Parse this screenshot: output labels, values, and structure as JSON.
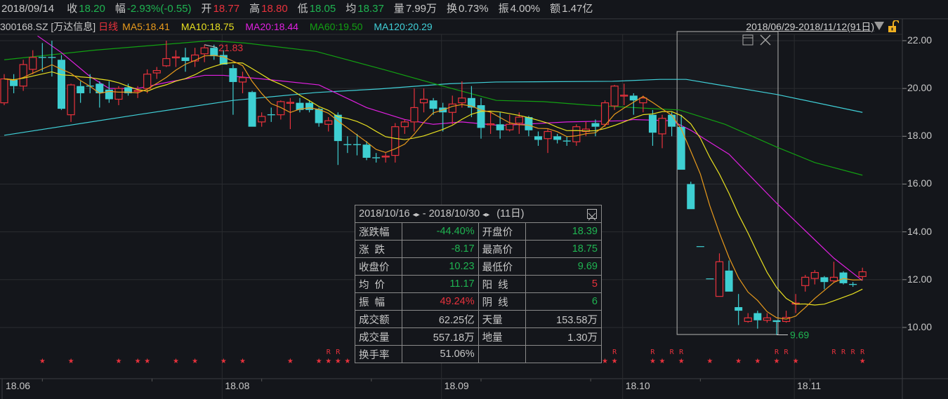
{
  "header": {
    "date": "2018/09/14",
    "items": [
      {
        "label": "收",
        "value": "18.20",
        "color": "g"
      },
      {
        "label": "幅",
        "value": "-2.93%(-0.55)",
        "color": "g"
      },
      {
        "label": "开",
        "value": "18.77",
        "color": "r"
      },
      {
        "label": "高",
        "value": "18.80",
        "color": "r"
      },
      {
        "label": "低",
        "value": "18.05",
        "color": "g"
      },
      {
        "label": "均",
        "value": "18.37",
        "color": "g"
      },
      {
        "label": "量",
        "value": "7.99万",
        "color": "w"
      },
      {
        "label": "换",
        "value": "0.73%",
        "color": "w"
      },
      {
        "label": "振",
        "value": "4.00%",
        "color": "w"
      },
      {
        "label": "额",
        "value": "1.47亿",
        "color": "w"
      }
    ]
  },
  "symbol": "300168.SZ [万达信息]",
  "period": "日线",
  "ma_legend": [
    {
      "label": "MA5:18.41",
      "color": "#e89a1c"
    },
    {
      "label": "MA10:18.75",
      "color": "#e8e020"
    },
    {
      "label": "MA20:18.44",
      "color": "#e020e0"
    },
    {
      "label": "MA60:19.50",
      "color": "#12a012"
    },
    {
      "label": "MA120:20.29",
      "color": "#40d0d8"
    }
  ],
  "range_label": "2018/06/29-2018/11/12(91日)",
  "stats": {
    "title_start": "2018/10/16",
    "title_end": "2018/10/30",
    "days": "(11日)",
    "rows": [
      {
        "l1": "涨跌幅",
        "v1": "-44.40%",
        "c1": "g",
        "l2": "开盘价",
        "v2": "18.39",
        "c2": "g"
      },
      {
        "l1": "涨  跌",
        "v1": "-8.17",
        "c1": "g",
        "l2": "最高价",
        "v2": "18.75",
        "c2": "g"
      },
      {
        "l1": "收盘价",
        "v1": "10.23",
        "c1": "g",
        "l2": "最低价",
        "v2": "9.69",
        "c2": "g"
      },
      {
        "l1": "均  价",
        "v1": "11.17",
        "c1": "g",
        "l2": "阳  线",
        "v2": "5",
        "c2": "r"
      },
      {
        "l1": "振  幅",
        "v1": "49.24%",
        "c1": "r",
        "l2": "阴  线",
        "v2": "6",
        "c2": "g"
      },
      {
        "l1": "成交额",
        "v1": "62.25亿",
        "c1": "w",
        "l2": "天量",
        "v2": "153.58万",
        "c2": "w"
      },
      {
        "l1": "成交量",
        "v1": "557.18万",
        "c1": "w",
        "l2": "地量",
        "v2": "1.30万",
        "c2": "w"
      },
      {
        "l1": "换手率",
        "v1": "51.06%",
        "c1": "w",
        "l2": "",
        "v2": "",
        "c2": "w"
      }
    ]
  },
  "chart_data": {
    "type": "candlestick",
    "ylim": [
      9.0,
      22.6
    ],
    "y_ticks": [
      "22.00",
      "20.00",
      "18.00",
      "16.00",
      "14.00",
      "12.00",
      "10.00"
    ],
    "x_ticks": [
      {
        "label": "18.06",
        "index": 0
      },
      {
        "label": "18.08",
        "index": 23
      },
      {
        "label": "18.09",
        "index": 46
      },
      {
        "label": "18.10",
        "index": 65
      },
      {
        "label": "18.11",
        "index": 83
      }
    ],
    "colors": {
      "up": "#e8323c",
      "down": "#3ecfd2"
    },
    "ohlc": [
      [
        19.4,
        20.6,
        19.3,
        20.4
      ],
      [
        20.36,
        20.6,
        19.8,
        20.1
      ],
      [
        20.1,
        21.2,
        19.9,
        21.0
      ],
      [
        20.8,
        21.6,
        20.6,
        21.3
      ],
      [
        21.32,
        21.9,
        20.7,
        21.28
      ],
      [
        21.32,
        22.0,
        20.5,
        21.28
      ],
      [
        21.2,
        21.4,
        19.1,
        19.15
      ],
      [
        18.9,
        20.2,
        18.6,
        20.15
      ],
      [
        20.1,
        20.3,
        19.4,
        19.8
      ],
      [
        20.12,
        20.6,
        19.8,
        20.08
      ],
      [
        20.2,
        20.3,
        19.2,
        19.8
      ],
      [
        19.95,
        20.3,
        19.4,
        19.55
      ],
      [
        19.55,
        20.1,
        19.3,
        20.0
      ],
      [
        20.05,
        20.2,
        19.7,
        19.8
      ],
      [
        19.88,
        20.1,
        19.6,
        19.92
      ],
      [
        20.0,
        20.8,
        19.8,
        20.6
      ],
      [
        20.65,
        20.9,
        20.4,
        20.75
      ],
      [
        20.95,
        22.0,
        20.9,
        21.25
      ],
      [
        21.28,
        21.6,
        20.9,
        21.32
      ],
      [
        21.3,
        21.7,
        20.7,
        21.15
      ],
      [
        21.15,
        21.7,
        20.9,
        21.4
      ],
      [
        21.45,
        21.83,
        21.1,
        21.7
      ],
      [
        21.7,
        21.83,
        21.2,
        21.35
      ],
      [
        21.4,
        21.6,
        21.0,
        21.0
      ],
      [
        20.85,
        21.0,
        18.9,
        20.27
      ],
      [
        20.27,
        20.7,
        19.8,
        20.45
      ],
      [
        19.85,
        19.9,
        18.4,
        18.4
      ],
      [
        18.6,
        19.0,
        18.4,
        18.83
      ],
      [
        18.92,
        19.2,
        18.6,
        18.88
      ],
      [
        18.9,
        19.5,
        18.7,
        19.45
      ],
      [
        19.38,
        19.6,
        18.3,
        19.42
      ],
      [
        19.4,
        19.6,
        19.0,
        19.1
      ],
      [
        19.4,
        19.5,
        19.0,
        19.1
      ],
      [
        19.15,
        19.2,
        18.4,
        18.55
      ],
      [
        18.5,
        18.8,
        18.2,
        18.65
      ],
      [
        18.9,
        19.0,
        16.8,
        17.8
      ],
      [
        17.67,
        18.0,
        17.3,
        17.63
      ],
      [
        17.67,
        18.1,
        17.2,
        17.63
      ],
      [
        17.65,
        17.8,
        17.0,
        17.1
      ],
      [
        17.12,
        17.3,
        16.9,
        17.08
      ],
      [
        17.13,
        17.3,
        16.9,
        17.17
      ],
      [
        17.2,
        18.55,
        16.9,
        18.4
      ],
      [
        18.4,
        18.7,
        18.1,
        18.6
      ],
      [
        18.6,
        20.0,
        18.2,
        19.2
      ],
      [
        19.4,
        20.0,
        19.0,
        19.55
      ],
      [
        19.5,
        19.6,
        18.9,
        19.15
      ],
      [
        19.2,
        19.4,
        18.2,
        19.0
      ],
      [
        19.0,
        19.7,
        18.5,
        19.35
      ],
      [
        19.4,
        20.3,
        19.2,
        19.6
      ],
      [
        19.6,
        20.1,
        18.8,
        19.2
      ],
      [
        19.3,
        19.6,
        17.9,
        18.35
      ],
      [
        18.48,
        19.0,
        18.1,
        18.52
      ],
      [
        18.5,
        19.0,
        17.9,
        18.25
      ],
      [
        18.27,
        18.9,
        18.2,
        18.5
      ],
      [
        18.55,
        19.0,
        18.1,
        18.8
      ],
      [
        18.8,
        18.85,
        18.0,
        18.25
      ],
      [
        18.0,
        18.2,
        17.6,
        17.85
      ],
      [
        17.9,
        18.3,
        17.3,
        18.2
      ],
      [
        18.0,
        18.1,
        17.7,
        17.85
      ],
      [
        17.82,
        18.0,
        17.6,
        17.78
      ],
      [
        17.77,
        18.5,
        17.6,
        18.4
      ],
      [
        18.2,
        18.6,
        18.0,
        18.3
      ],
      [
        18.55,
        18.7,
        18.0,
        18.4
      ],
      [
        18.5,
        19.5,
        18.4,
        19.4
      ],
      [
        19.27,
        20.15,
        19.1,
        20.1
      ],
      [
        19.68,
        20.2,
        19.3,
        19.72
      ],
      [
        19.7,
        19.8,
        18.9,
        19.5
      ],
      [
        19.4,
        19.7,
        19.0,
        19.6
      ],
      [
        18.9,
        19.1,
        17.6,
        18.15
      ],
      [
        18.1,
        18.9,
        17.5,
        18.75
      ],
      [
        18.9,
        19.0,
        18.0,
        18.4
      ],
      [
        18.39,
        18.9,
        16.6,
        16.6
      ],
      [
        16.0,
        16.1,
        14.95,
        14.95
      ],
      [
        13.4,
        13.4,
        13.4,
        13.4
      ],
      [
        12.05,
        12.05,
        12.05,
        12.05
      ],
      [
        11.3,
        13.1,
        11.3,
        12.75
      ],
      [
        12.38,
        12.8,
        11.5,
        11.5
      ],
      [
        10.85,
        11.4,
        10.1,
        10.7
      ],
      [
        10.25,
        10.6,
        10.2,
        10.4
      ],
      [
        10.6,
        10.7,
        9.95,
        10.3
      ],
      [
        10.3,
        10.6,
        10.2,
        10.4
      ],
      [
        10.3,
        10.3,
        9.69,
        10.23
      ],
      [
        10.25,
        10.7,
        10.2,
        10.42
      ],
      [
        10.98,
        11.4,
        10.6,
        11.02
      ],
      [
        11.75,
        12.2,
        11.5,
        12.1
      ],
      [
        12.05,
        12.4,
        11.8,
        12.3
      ],
      [
        12.1,
        12.15,
        11.6,
        11.9
      ],
      [
        11.95,
        12.75,
        11.9,
        12.1
      ],
      [
        12.3,
        12.35,
        11.8,
        11.85
      ],
      [
        11.82,
        11.9,
        11.7,
        11.78
      ],
      [
        12.13,
        12.5,
        12.0,
        12.33
      ]
    ],
    "ma20_points": [
      [
        3.5,
        22.2
      ],
      [
        6,
        21.5
      ],
      [
        9,
        20.5
      ],
      [
        11,
        20.0
      ],
      [
        14,
        20.0
      ],
      [
        17,
        20.25
      ],
      [
        21,
        20.55
      ],
      [
        23,
        20.55
      ],
      [
        27,
        20.4
      ],
      [
        33,
        20.15
      ],
      [
        38,
        19.2
      ],
      [
        42,
        18.7
      ],
      [
        45,
        18.5
      ],
      [
        48,
        18.6
      ],
      [
        52,
        18.45
      ],
      [
        59,
        18.6
      ],
      [
        65,
        18.65
      ],
      [
        66,
        18.7
      ],
      [
        70,
        18.65
      ],
      [
        72,
        18.25
      ],
      [
        76,
        17.25
      ],
      [
        81,
        15.2
      ],
      [
        87,
        12.9
      ],
      [
        90,
        11.96
      ]
    ],
    "ma60_points": [
      [
        0,
        21.2
      ],
      [
        9.4,
        21.6
      ],
      [
        21.6,
        22.0
      ],
      [
        25.3,
        21.9
      ],
      [
        32.7,
        21.55
      ],
      [
        40,
        20.77
      ],
      [
        46,
        20.1
      ],
      [
        51.6,
        19.5
      ],
      [
        56.5,
        19.45
      ],
      [
        61.4,
        19.3
      ],
      [
        68.3,
        19.15
      ],
      [
        70.8,
        19.1
      ],
      [
        75.6,
        18.5
      ],
      [
        81,
        17.55
      ],
      [
        85,
        16.9
      ],
      [
        90,
        16.37
      ]
    ],
    "ma120_points": [
      [
        0,
        18.04
      ],
      [
        14.3,
        18.92
      ],
      [
        24,
        19.5
      ],
      [
        32.7,
        19.83
      ],
      [
        39.3,
        19.98
      ],
      [
        46.7,
        20.2
      ],
      [
        51.6,
        20.27
      ],
      [
        63.8,
        20.3
      ],
      [
        68.8,
        20.38
      ],
      [
        71.5,
        20.38
      ],
      [
        81,
        19.75
      ],
      [
        90,
        19.0
      ]
    ],
    "high_label": {
      "text": "21.83",
      "index": 21,
      "value": 21.83
    },
    "low_label": {
      "text": "9.69",
      "index": 81,
      "value": 9.69
    },
    "selection": {
      "start_index": 71,
      "end_index": 81
    },
    "star_marks": [
      4,
      7,
      12,
      14,
      15,
      18,
      20,
      23,
      25,
      30,
      33,
      34,
      35,
      36,
      63,
      64,
      68,
      69,
      71,
      74,
      77,
      79,
      81,
      83,
      90
    ],
    "r_marks": [
      34,
      35,
      64,
      68,
      70,
      71,
      81,
      82,
      87,
      88,
      89,
      90
    ],
    "r_text": "R",
    "star_text": "★"
  }
}
